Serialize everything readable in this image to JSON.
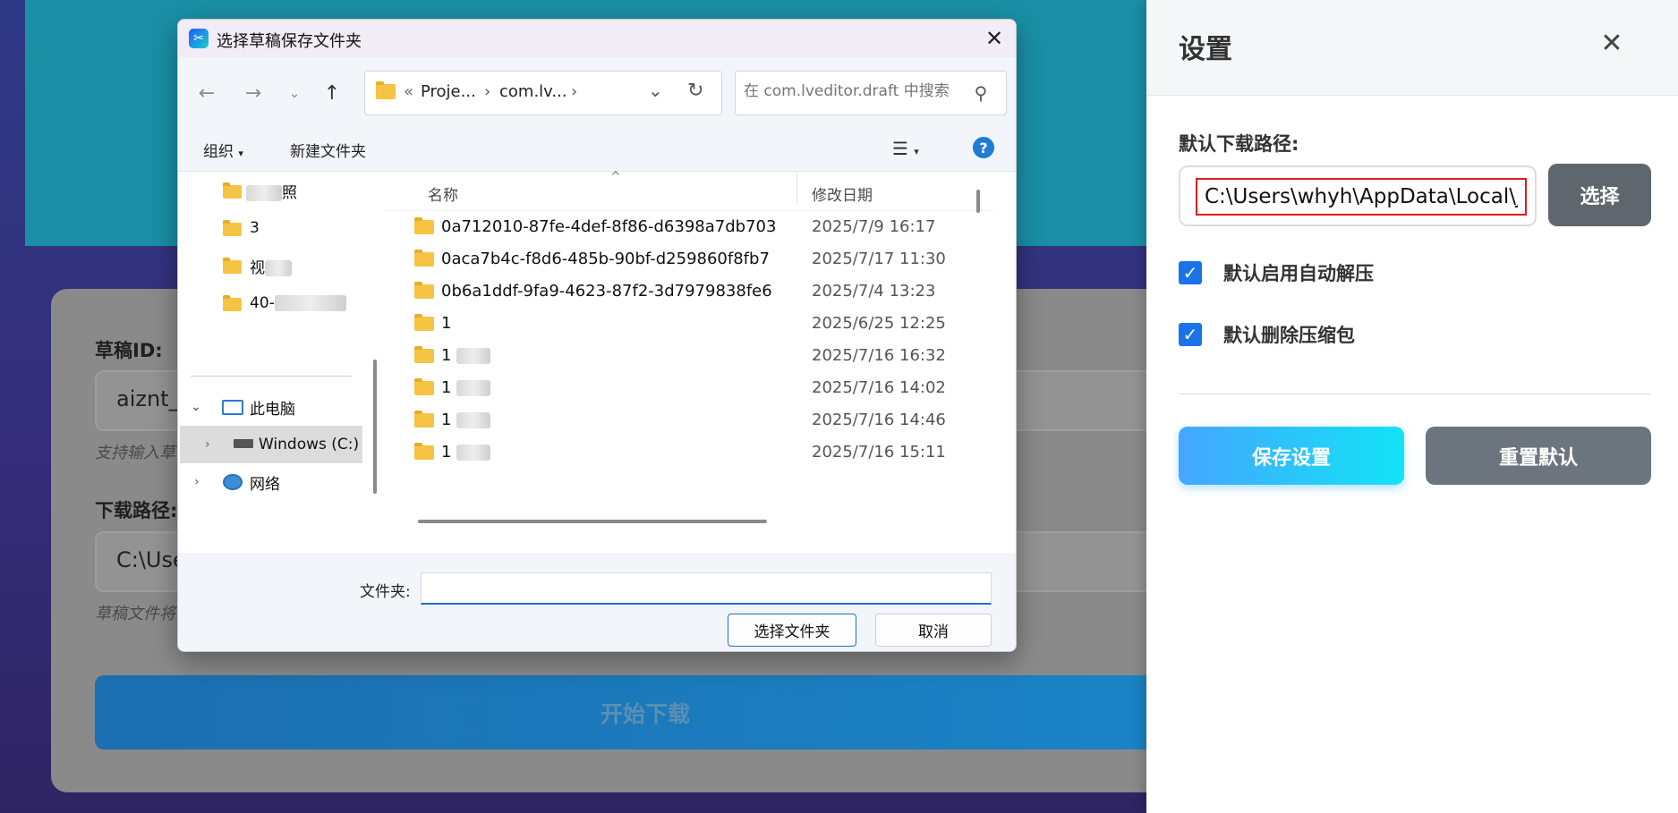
{
  "background_app": {
    "draft_id_label": "草稿ID:",
    "draft_id_value": "aiznt_",
    "draft_id_hint": "支持输入草",
    "download_path_label": "下载路径:",
    "download_path_value": "C:\\Use",
    "download_path_hint": "草稿文件将",
    "start_button": "开始下载"
  },
  "settings": {
    "title": "设置",
    "close_icon": "close-icon",
    "default_path_label": "默认下载路径:",
    "default_path_value": "C:\\Users\\whyh\\AppData\\Local\\Jia",
    "choose_button": "选择",
    "auto_extract_label": "默认启用自动解压",
    "auto_extract_checked": true,
    "delete_archive_label": "默认删除压缩包",
    "delete_archive_checked": true,
    "save_button": "保存设置",
    "reset_button": "重置默认"
  },
  "dialog": {
    "title": "选择草稿保存文件夹",
    "address": {
      "overflow": "«",
      "segment1": "Proje...",
      "segment2": "com.lv...",
      "sep": "›"
    },
    "search_placeholder": "在 com.lveditor.draft 中搜索",
    "toolbar": {
      "organize": "组织",
      "new_folder": "新建文件夹"
    },
    "tree": [
      {
        "label": "照",
        "kind": "folder"
      },
      {
        "label": "3",
        "kind": "folder"
      },
      {
        "label": "视",
        "kind": "folder"
      },
      {
        "label": "40-",
        "kind": "folder"
      }
    ],
    "this_pc": "此电脑",
    "windows_drive": "Windows (C:)",
    "network": "网络",
    "columns": {
      "name": "名称",
      "date": "修改日期"
    },
    "files": [
      {
        "name": "0a712010-87fe-4def-8f86-d6398a7db703",
        "date": "2025/7/9 16:17"
      },
      {
        "name": "0aca7b4c-f8d6-485b-90bf-d259860f8fb7",
        "date": "2025/7/17 11:30"
      },
      {
        "name": "0b6a1ddf-9fa9-4623-87f2-3d7979838fe6",
        "date": "2025/7/4 13:23"
      },
      {
        "name": "1",
        "date": "2025/6/25 12:25"
      },
      {
        "name": "1",
        "date": "2025/7/16 16:32"
      },
      {
        "name": "1",
        "date": "2025/7/16 14:02"
      },
      {
        "name": "1",
        "date": "2025/7/16 14:46"
      },
      {
        "name": "1",
        "date": "2025/7/16 15:11"
      }
    ],
    "folder_label": "文件夹:",
    "folder_value": "",
    "select_button": "选择文件夹",
    "cancel_button": "取消"
  }
}
